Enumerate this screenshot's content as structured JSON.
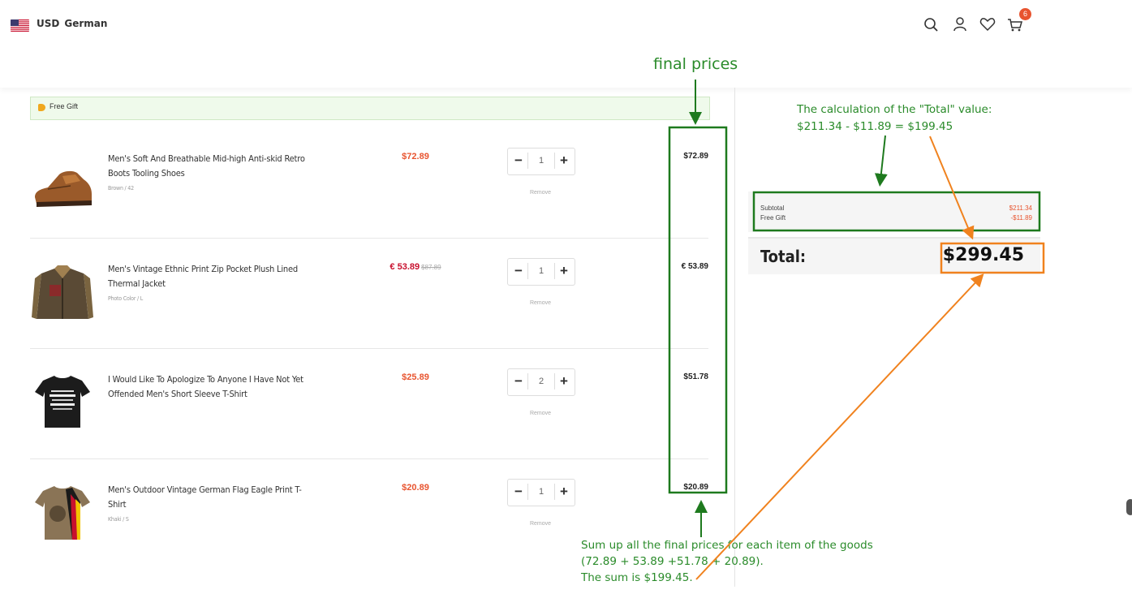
{
  "header": {
    "currency": "USD",
    "language": "German",
    "cart_count": "6",
    "icons": [
      "search-icon",
      "user-icon",
      "heart-icon",
      "cart-icon"
    ]
  },
  "gift_bar": {
    "label": "Free Gift"
  },
  "items": [
    {
      "name": "Men's Soft And Breathable Mid-high Anti-skid Retro Boots Tooling Shoes",
      "variant": "Brown / 42",
      "unit_price": "$72.89",
      "old_price": "",
      "quantity": "1",
      "remove_label": "Remove",
      "final_price": "$72.89"
    },
    {
      "name": "Men's Vintage Ethnic Print Zip Pocket Plush Lined Thermal Jacket",
      "variant": "Photo Color / L",
      "unit_price": "€ 53.89",
      "old_price": "$87.89",
      "quantity": "1",
      "remove_label": "Remove",
      "final_price": "€ 53.89"
    },
    {
      "name": "I Would Like To Apologize To Anyone I Have Not Yet Offended Men's Short Sleeve T-Shirt",
      "variant": "",
      "unit_price": "$25.89",
      "old_price": "",
      "quantity": "2",
      "remove_label": "Remove",
      "final_price": "$51.78"
    },
    {
      "name": "Men's Outdoor Vintage German Flag Eagle Print T-Shirt",
      "variant": "Khaki / S",
      "unit_price": "$20.89",
      "old_price": "",
      "quantity": "1",
      "remove_label": "Remove",
      "final_price": "$20.89"
    }
  ],
  "summary": {
    "subtotal_label": "Subtotal",
    "subtotal_value": "$211.34",
    "gift_label": "Free Gift",
    "gift_value": "-$11.89",
    "total_label": "Total:",
    "total_value": "$299.45"
  },
  "annotations": {
    "final_prices": "final prices",
    "calc_line1": "The calculation of the \"Total\" value:",
    "calc_line2": "$211.34 - $11.89 = $199.45",
    "sum_line1": "Sum up all the final prices for each item of the goods",
    "sum_line2": "(72.89 + 53.89 +51.78 + 20.89).",
    "sum_line3": "The sum is $199.45."
  },
  "colors": {
    "price_orange": "#e8542f",
    "price_red": "#c8102e",
    "annotation_green": "#1e7a1e",
    "annotation_orange": "#f0821e"
  }
}
